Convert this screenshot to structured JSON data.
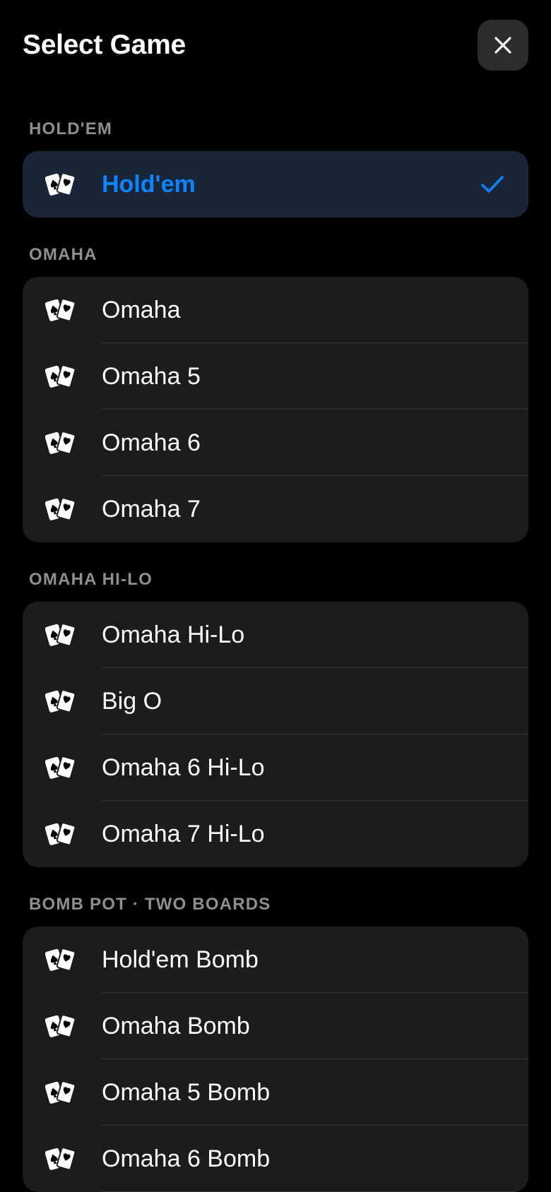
{
  "header": {
    "title": "Select Game",
    "close_icon": "close-icon"
  },
  "colors": {
    "background": "#000000",
    "group_bg": "#1c1c1e",
    "selected_bg": "#1b2538",
    "accent": "#0a84ff",
    "section_title": "#8e8e93",
    "divider": "#38383a"
  },
  "sections": [
    {
      "title": "HOLD'EM",
      "items": [
        {
          "label": "Hold'em",
          "icon": "playing-cards-icon",
          "selected": true
        }
      ]
    },
    {
      "title": "OMAHA",
      "items": [
        {
          "label": "Omaha",
          "icon": "playing-cards-icon"
        },
        {
          "label": "Omaha 5",
          "icon": "playing-cards-icon"
        },
        {
          "label": "Omaha 6",
          "icon": "playing-cards-icon"
        },
        {
          "label": "Omaha 7",
          "icon": "playing-cards-icon"
        }
      ]
    },
    {
      "title": "OMAHA HI-LO",
      "items": [
        {
          "label": "Omaha Hi-Lo",
          "icon": "playing-cards-icon"
        },
        {
          "label": "Big O",
          "icon": "playing-cards-icon"
        },
        {
          "label": "Omaha 6 Hi-Lo",
          "icon": "playing-cards-icon"
        },
        {
          "label": "Omaha 7 Hi-Lo",
          "icon": "playing-cards-icon"
        }
      ]
    },
    {
      "title": "BOMB POT · TWO BOARDS",
      "items": [
        {
          "label": "Hold'em Bomb",
          "icon": "playing-cards-icon"
        },
        {
          "label": "Omaha Bomb",
          "icon": "playing-cards-icon"
        },
        {
          "label": "Omaha 5 Bomb",
          "icon": "playing-cards-icon"
        },
        {
          "label": "Omaha 6 Bomb",
          "icon": "playing-cards-icon"
        }
      ]
    }
  ]
}
